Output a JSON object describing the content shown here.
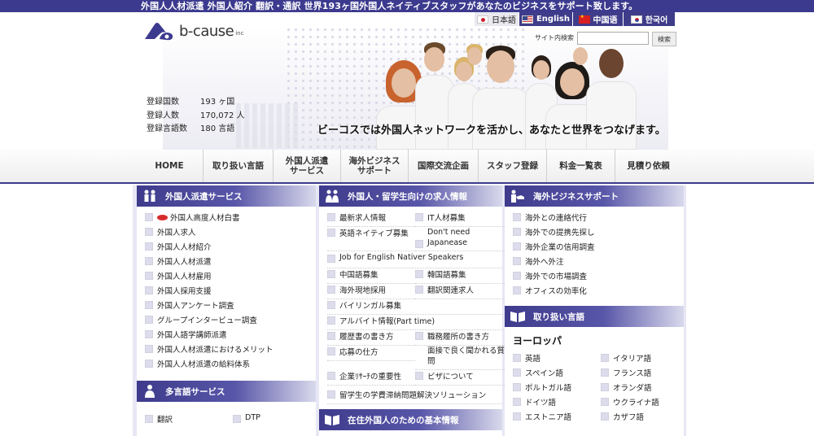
{
  "header": {
    "tagline": "外国人人材派遣 外国人紹介 翻訳・通訳 世界193ヶ国外国人ネイティブスタッフがあなたのビジネスをサポート致します。",
    "logo_text": "b-cause",
    "logo_suffix": "inc",
    "languages": [
      {
        "label": "日本語",
        "flag": "flag-jp",
        "active": false
      },
      {
        "label": "English",
        "flag": "flag-us",
        "active": true
      },
      {
        "label": "中国语",
        "flag": "flag-cn",
        "active": true
      },
      {
        "label": "한국어",
        "flag": "flag-kr",
        "active": true
      }
    ],
    "search_label": "サイト内検索",
    "search_value": "",
    "search_button": "検索"
  },
  "hero": {
    "stats": [
      {
        "label": "登録国数",
        "value": "193 ヶ国"
      },
      {
        "label": "登録人数",
        "value": "170,072 人"
      },
      {
        "label": "登録言語数",
        "value": "180 言語"
      }
    ],
    "catchphrase": "ビーコスでは外国人ネットワークを活かし、あなたと世界をつなげます。"
  },
  "nav": [
    "HOME",
    "取り扱い言語",
    "外国人派遣\nサービス",
    "海外ビジネス\nサポート",
    "国際交流企画",
    "スタッフ登録",
    "料金一覧表",
    "見積り依頼"
  ],
  "col1": {
    "title": "外国人派遣サービス",
    "links": [
      "外国人高度人材白書",
      "外国人求人",
      "外国人人材紹介",
      "外国人人材派遣",
      "外国人人材雇用",
      "外国人採用支援",
      "外国人アンケート調査",
      "グループインタービュー調査",
      "外国人語学講師派遣",
      "外国人人材派遣におけるメリット",
      "外国人人材派遣の給料体系"
    ],
    "title2": "多言語サービス",
    "links2": [
      "翻訳",
      "DTP"
    ]
  },
  "col2": {
    "title": "外国人・留学生向けの求人情報",
    "links_a": [
      "最新求人情報",
      "IT人材募集",
      "英語ネイティブ募集",
      "Don't need Japanease"
    ],
    "link_full": "Job for English Nativer Speakers",
    "links_b": [
      "中国語募集",
      "韓国語募集",
      "海外現地採用",
      "翻訳関連求人"
    ],
    "link_full2": "バイリンガル募集",
    "link_full3": "アルバイト情報(Part time)",
    "links_c": [
      "履歴書の書き方",
      "職務履所の書き方",
      "応募の仕方",
      "面接で良く聞かれる質問",
      "企業ﾘｻｰﾁの重要性",
      "ビザについて"
    ],
    "link_full4": "留学生の学費滞納問題解決ソリューション",
    "title2": "在住外国人のための基本情報"
  },
  "col3": {
    "title": "海外ビジネスサポート",
    "links": [
      "海外との連絡代行",
      "海外での提携先探し",
      "海外企業の信用調査",
      "海外へ外注",
      "海外での市場調査",
      "オフィスの効率化"
    ],
    "title2": "取り扱い言語",
    "region": "ヨーロッパ",
    "languages": [
      "英語",
      "イタリア語",
      "スペイン語",
      "フランス語",
      "ポルトガル語",
      "オランダ語",
      "ドイツ語",
      "ウクライナ語",
      "エストニア語",
      "カザフ語"
    ]
  },
  "colors": {
    "brand": "#3c3a8e",
    "accent": "#5856a8",
    "new_badge": "#d82c2c"
  },
  "icons": [
    "people-icon",
    "search-icon",
    "handshake-icon",
    "book-icon",
    "person-icon"
  ]
}
